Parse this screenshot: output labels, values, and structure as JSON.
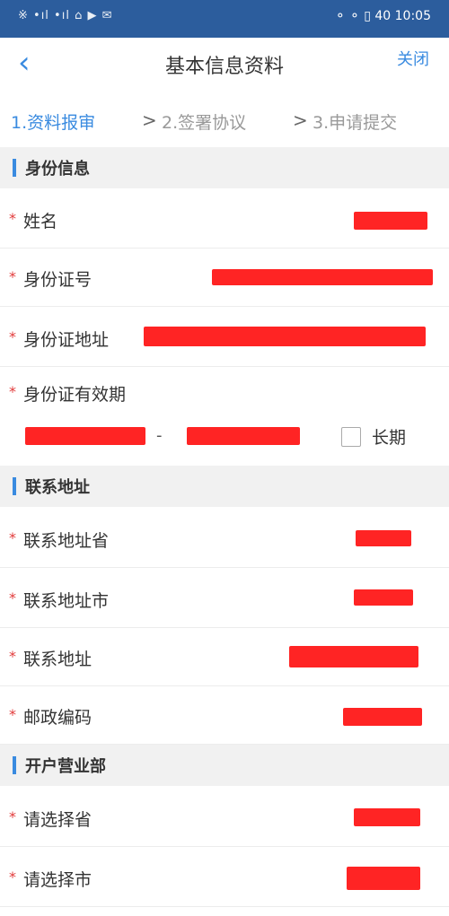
{
  "status_bar": {
    "left": "※ •ıl  •ıl  ⌂  ▶ ✉",
    "right": "⚬ ⚬ ▯ 40 10:05"
  },
  "nav": {
    "title": "基本信息资料",
    "back_icon": "chevron-left",
    "close_label": "关闭"
  },
  "steps": [
    {
      "label": "1.资料报审",
      "active": true
    },
    {
      "label": "2.签署协议",
      "active": false
    },
    {
      "label": "3.申请提交",
      "active": false
    }
  ],
  "step_separator": ">",
  "sections": {
    "identity": {
      "title": "身份信息",
      "name_label": "姓名",
      "id_number_label": "身份证号",
      "id_address_label": "身份证地址",
      "validity_label": "身份证有效期",
      "validity_separator": "-",
      "long_term_label": "长期"
    },
    "contact": {
      "title": "联系地址",
      "province_label": "联系地址省",
      "city_label": "联系地址市",
      "address_label": "联系地址",
      "postcode_label": "邮政编码"
    },
    "branch": {
      "title": "开户营业部",
      "province_label": "请选择省",
      "city_label": "请选择市"
    }
  },
  "required_mark": "*",
  "colors": {
    "accent": "#3a8be0",
    "status_bar": "#2c5d9d",
    "required": "#e23b3b",
    "redaction": "#ff2424"
  }
}
